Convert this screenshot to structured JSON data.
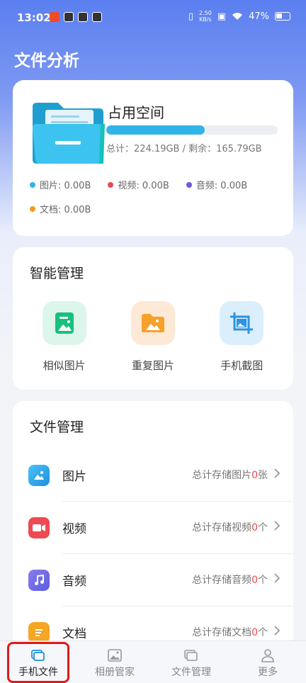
{
  "status_bar": {
    "time": "13:02",
    "net_speed_value": "2.50",
    "net_speed_unit": "KB/s",
    "battery": "47%"
  },
  "page_title": "文件分析",
  "storage": {
    "title": "占用空间",
    "used_fraction": 0.575,
    "total_text": "总计：224.19GB / 剩余：165.79GB",
    "legend": [
      {
        "label": "图片: 0.00B",
        "color": "#30b4e8"
      },
      {
        "label": "视频: 0.00B",
        "color": "#e84855"
      },
      {
        "label": "音频: 0.00B",
        "color": "#6a5ae0"
      },
      {
        "label": "文档: 0.00B",
        "color": "#f29a1a"
      }
    ]
  },
  "smart": {
    "title": "智能管理",
    "tools": [
      {
        "label": "相似图片",
        "icon": "similar-image-icon"
      },
      {
        "label": "重复图片",
        "icon": "duplicate-image-icon"
      },
      {
        "label": "手机截图",
        "icon": "screenshot-icon"
      }
    ]
  },
  "files": {
    "title": "文件管理",
    "rows": [
      {
        "name": "图片",
        "prefix": "总计存储图片",
        "count": "0",
        "unit": "张",
        "icon": "image-icon"
      },
      {
        "name": "视频",
        "prefix": "总计存储视频",
        "count": "0",
        "unit": "个",
        "icon": "video-icon"
      },
      {
        "name": "音频",
        "prefix": "总计存储音频",
        "count": "0",
        "unit": "个",
        "icon": "audio-icon"
      },
      {
        "name": "文档",
        "prefix": "总计存储文档",
        "count": "0",
        "unit": "个",
        "icon": "document-icon"
      }
    ]
  },
  "tabs": [
    {
      "label": "手机文件",
      "icon": "phone-files-icon",
      "active": true
    },
    {
      "label": "相册管家",
      "icon": "album-icon",
      "active": false
    },
    {
      "label": "文件管理",
      "icon": "folder-icon",
      "active": false
    },
    {
      "label": "更多",
      "icon": "person-icon",
      "active": false
    }
  ],
  "colors": {
    "accent": "#30b4e8",
    "count_red": "#e84850",
    "highlight": "#e01a1a"
  }
}
